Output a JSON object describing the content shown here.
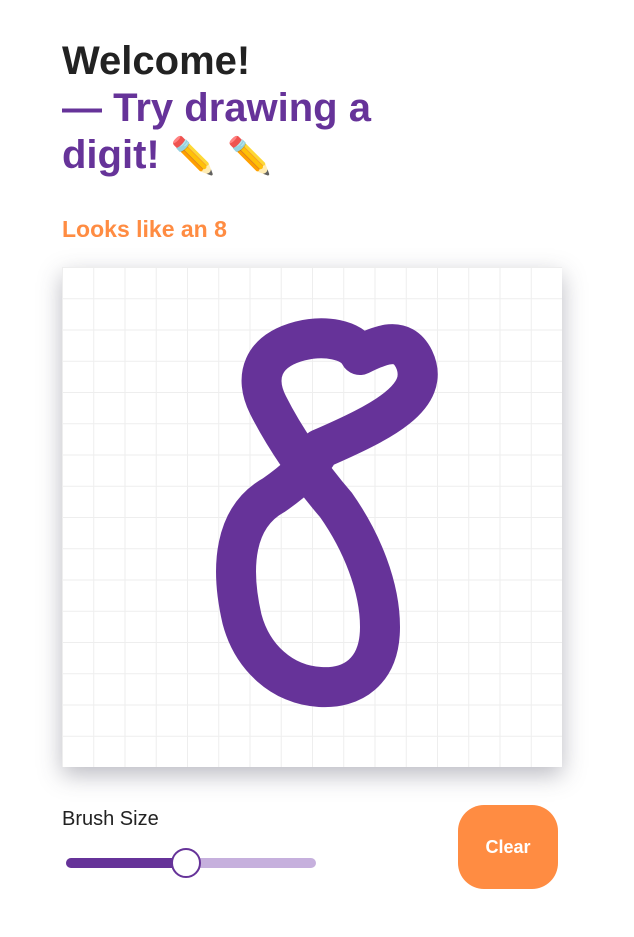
{
  "header": {
    "welcome": "Welcome!",
    "prompt": "— Try drawing a digit!",
    "pencils": "✏️ ✏️"
  },
  "prediction": {
    "text": "Looks like an 8"
  },
  "canvas": {
    "stroke_color": "#663399",
    "drawn_digit": "8"
  },
  "controls": {
    "brush_label": "Brush Size",
    "brush_level_fraction": 0.48,
    "clear_label": "Clear"
  },
  "colors": {
    "primary": "#663399",
    "accent": "#ff8c42",
    "heading": "#222222"
  }
}
